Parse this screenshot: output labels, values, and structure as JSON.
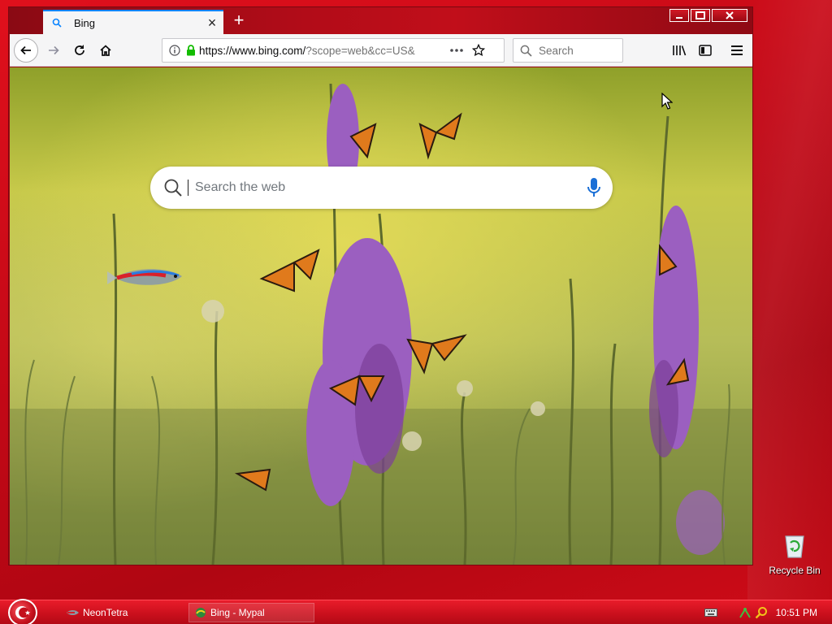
{
  "browser": {
    "tab": {
      "title": "Bing"
    },
    "url": {
      "main": "https://www.bing.com/",
      "rest": "?scope=web&cc=US&"
    },
    "search_placeholder": "Search"
  },
  "bing": {
    "search_placeholder": "Search the web"
  },
  "desktop": {
    "icons": [
      {
        "label": "Recycle Bin"
      }
    ]
  },
  "taskbar": {
    "items": [
      {
        "label": "NeonTetra"
      },
      {
        "label": "Bing - Mypal"
      }
    ],
    "clock": "10:51 PM"
  },
  "colors": {
    "theme_red": "#c10816",
    "tab_accent": "#0a84ff",
    "secure_green": "#12bc00"
  }
}
